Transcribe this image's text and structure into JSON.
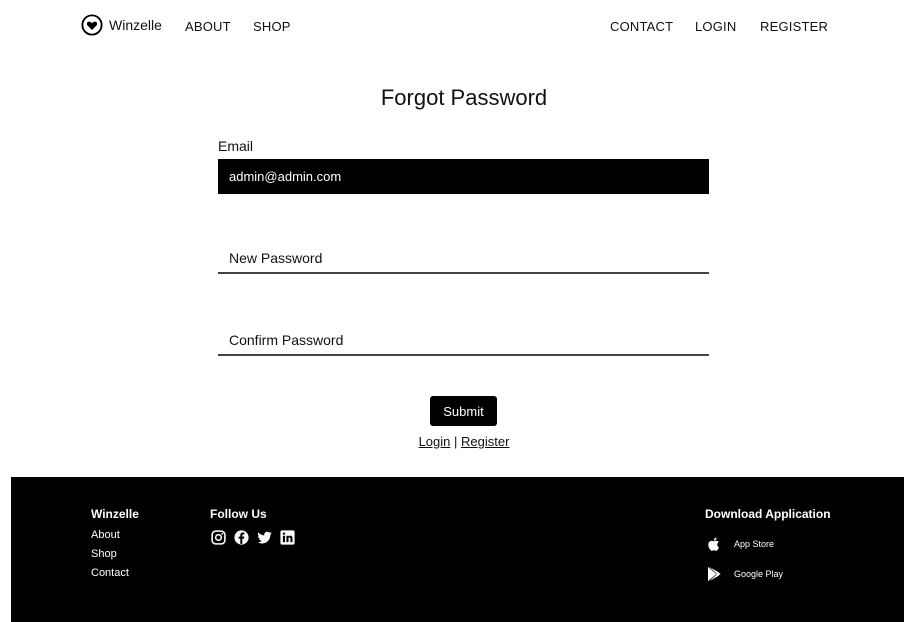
{
  "header": {
    "brand": "Winzelle",
    "nav_left": [
      "ABOUT",
      "SHOP"
    ],
    "nav_right": [
      "CONTACT",
      "LOGIN",
      "REGISTER"
    ]
  },
  "form": {
    "title": "Forgot Password",
    "email_label": "Email",
    "email_value": "admin@admin.com",
    "new_password_placeholder": "New Password",
    "confirm_password_placeholder": "Confirm Password",
    "submit_label": "Submit",
    "login_link": "Login",
    "separator": "|",
    "register_link": "Register"
  },
  "footer": {
    "brand_heading": "Winzelle",
    "links": [
      "About",
      "Shop",
      "Contact"
    ],
    "follow_heading": "Follow Us",
    "social_icons": [
      "instagram-icon",
      "facebook-icon",
      "twitter-icon",
      "linkedin-icon"
    ],
    "download_heading": "Download Application",
    "app_store": "App Store",
    "google_play": "Google Play"
  },
  "colors": {
    "primary": "#000000",
    "background": "#ffffff",
    "text": "#111111"
  }
}
